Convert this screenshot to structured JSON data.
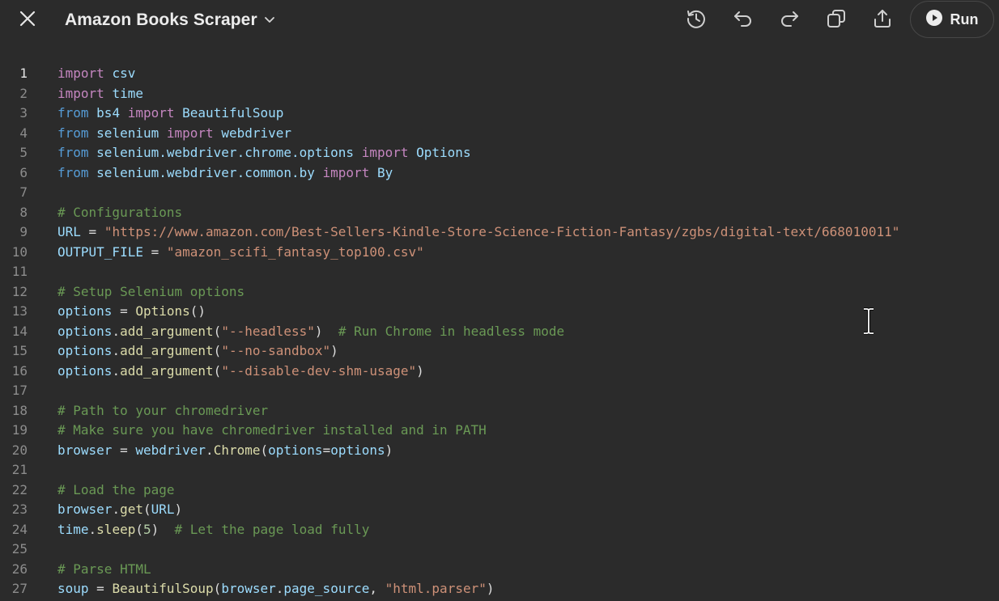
{
  "app": {
    "title": "Amazon Books Scraper",
    "run_label": "Run"
  },
  "toolbar": {
    "icons": [
      "close-icon",
      "chevron-down-icon",
      "history-icon",
      "undo-icon",
      "redo-icon",
      "copy-icon",
      "share-icon",
      "play-icon"
    ]
  },
  "colors": {
    "background": "#2b2b2b",
    "keyword": "#c586c0",
    "keyword_blue": "#569cd6",
    "string": "#ce9178",
    "comment": "#6a9955",
    "function": "#dcdcaa",
    "variable": "#9cdcfe"
  },
  "editor": {
    "active_line": 1,
    "lines": [
      {
        "n": "1",
        "t": [
          [
            "kw",
            "import"
          ],
          [
            "p",
            " "
          ],
          [
            "var",
            "csv"
          ]
        ]
      },
      {
        "n": "2",
        "t": [
          [
            "kw",
            "import"
          ],
          [
            "p",
            " "
          ],
          [
            "var",
            "time"
          ]
        ]
      },
      {
        "n": "3",
        "t": [
          [
            "kw2",
            "from"
          ],
          [
            "p",
            " "
          ],
          [
            "var",
            "bs4"
          ],
          [
            "p",
            " "
          ],
          [
            "kw",
            "import"
          ],
          [
            "p",
            " "
          ],
          [
            "var",
            "BeautifulSoup"
          ]
        ]
      },
      {
        "n": "4",
        "t": [
          [
            "kw2",
            "from"
          ],
          [
            "p",
            " "
          ],
          [
            "var",
            "selenium"
          ],
          [
            "p",
            " "
          ],
          [
            "kw",
            "import"
          ],
          [
            "p",
            " "
          ],
          [
            "var",
            "webdriver"
          ]
        ]
      },
      {
        "n": "5",
        "t": [
          [
            "kw2",
            "from"
          ],
          [
            "p",
            " "
          ],
          [
            "var",
            "selenium.webdriver.chrome.options"
          ],
          [
            "p",
            " "
          ],
          [
            "kw",
            "import"
          ],
          [
            "p",
            " "
          ],
          [
            "var",
            "Options"
          ]
        ]
      },
      {
        "n": "6",
        "t": [
          [
            "kw2",
            "from"
          ],
          [
            "p",
            " "
          ],
          [
            "var",
            "selenium.webdriver.common.by"
          ],
          [
            "p",
            " "
          ],
          [
            "kw",
            "import"
          ],
          [
            "p",
            " "
          ],
          [
            "var",
            "By"
          ]
        ]
      },
      {
        "n": "7",
        "t": []
      },
      {
        "n": "8",
        "t": [
          [
            "cm",
            "# Configurations"
          ]
        ]
      },
      {
        "n": "9",
        "t": [
          [
            "var",
            "URL"
          ],
          [
            "p",
            " = "
          ],
          [
            "str",
            "\"https://www.amazon.com/Best-Sellers-Kindle-Store-Science-Fiction-Fantasy/zgbs/digital-text/668010011\""
          ]
        ]
      },
      {
        "n": "10",
        "t": [
          [
            "var",
            "OUTPUT_FILE"
          ],
          [
            "p",
            " = "
          ],
          [
            "str",
            "\"amazon_scifi_fantasy_top100.csv\""
          ]
        ]
      },
      {
        "n": "11",
        "t": []
      },
      {
        "n": "12",
        "t": [
          [
            "cm",
            "# Setup Selenium options"
          ]
        ]
      },
      {
        "n": "13",
        "t": [
          [
            "var",
            "options"
          ],
          [
            "p",
            " = "
          ],
          [
            "fn",
            "Options"
          ],
          [
            "p",
            "()"
          ]
        ]
      },
      {
        "n": "14",
        "t": [
          [
            "var",
            "options"
          ],
          [
            "p",
            "."
          ],
          [
            "fn",
            "add_argument"
          ],
          [
            "p",
            "("
          ],
          [
            "str",
            "\"--headless\""
          ],
          [
            "p",
            ")  "
          ],
          [
            "cm",
            "# Run Chrome in headless mode"
          ]
        ]
      },
      {
        "n": "15",
        "t": [
          [
            "var",
            "options"
          ],
          [
            "p",
            "."
          ],
          [
            "fn",
            "add_argument"
          ],
          [
            "p",
            "("
          ],
          [
            "str",
            "\"--no-sandbox\""
          ],
          [
            "p",
            ")"
          ]
        ]
      },
      {
        "n": "16",
        "t": [
          [
            "var",
            "options"
          ],
          [
            "p",
            "."
          ],
          [
            "fn",
            "add_argument"
          ],
          [
            "p",
            "("
          ],
          [
            "str",
            "\"--disable-dev-shm-usage\""
          ],
          [
            "p",
            ")"
          ]
        ]
      },
      {
        "n": "17",
        "t": []
      },
      {
        "n": "18",
        "t": [
          [
            "cm",
            "# Path to your chromedriver"
          ]
        ]
      },
      {
        "n": "19",
        "t": [
          [
            "cm",
            "# Make sure you have chromedriver installed and in PATH"
          ]
        ]
      },
      {
        "n": "20",
        "t": [
          [
            "var",
            "browser"
          ],
          [
            "p",
            " = "
          ],
          [
            "var",
            "webdriver"
          ],
          [
            "p",
            "."
          ],
          [
            "fn",
            "Chrome"
          ],
          [
            "p",
            "("
          ],
          [
            "var",
            "options"
          ],
          [
            "p",
            "="
          ],
          [
            "var",
            "options"
          ],
          [
            "p",
            ")"
          ]
        ]
      },
      {
        "n": "21",
        "t": []
      },
      {
        "n": "22",
        "t": [
          [
            "cm",
            "# Load the page"
          ]
        ]
      },
      {
        "n": "23",
        "t": [
          [
            "var",
            "browser"
          ],
          [
            "p",
            "."
          ],
          [
            "fn",
            "get"
          ],
          [
            "p",
            "("
          ],
          [
            "var",
            "URL"
          ],
          [
            "p",
            ")"
          ]
        ]
      },
      {
        "n": "24",
        "t": [
          [
            "var",
            "time"
          ],
          [
            "p",
            "."
          ],
          [
            "fn",
            "sleep"
          ],
          [
            "p",
            "("
          ],
          [
            "num",
            "5"
          ],
          [
            "p",
            ")  "
          ],
          [
            "cm",
            "# Let the page load fully"
          ]
        ]
      },
      {
        "n": "25",
        "t": []
      },
      {
        "n": "26",
        "t": [
          [
            "cm",
            "# Parse HTML"
          ]
        ]
      },
      {
        "n": "27",
        "t": [
          [
            "var",
            "soup"
          ],
          [
            "p",
            " = "
          ],
          [
            "fn",
            "BeautifulSoup"
          ],
          [
            "p",
            "("
          ],
          [
            "var",
            "browser"
          ],
          [
            "p",
            "."
          ],
          [
            "var",
            "page_source"
          ],
          [
            "p",
            ", "
          ],
          [
            "str",
            "\"html.parser\""
          ],
          [
            "p",
            ")"
          ]
        ]
      }
    ]
  }
}
